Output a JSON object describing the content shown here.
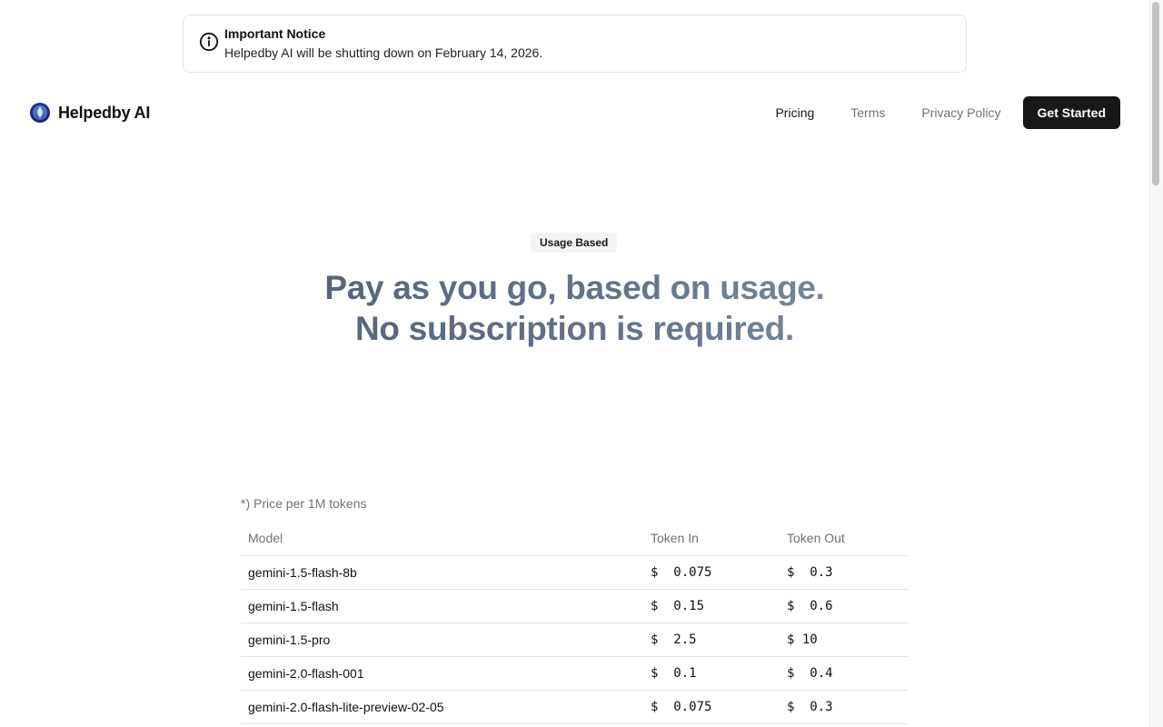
{
  "notice": {
    "title": "Important Notice",
    "message": "Helpedby AI will be shutting down on February 14, 2026.",
    "icon": "info-icon"
  },
  "brand": {
    "name": "Helpedby AI",
    "logo_icon": "helpedby-logo"
  },
  "nav": {
    "links": [
      "Pricing",
      "Terms",
      "Privacy Policy"
    ],
    "active": "Pricing",
    "cta_label": "Get Started"
  },
  "hero": {
    "badge": "Usage Based",
    "line1": "Pay as you go, based on usage.",
    "line2": "No subscription is required."
  },
  "pricing": {
    "note": "*) Price per 1M tokens",
    "columns": [
      "Model",
      "Token In",
      "Token Out"
    ],
    "currency": "$",
    "rows": [
      {
        "model": "gemini-1.5-flash-8b",
        "token_in": "0.075",
        "token_out": "0.3"
      },
      {
        "model": "gemini-1.5-flash",
        "token_in": "0.15",
        "token_out": "0.6"
      },
      {
        "model": "gemini-1.5-pro",
        "token_in": "2.5",
        "token_out": "10"
      },
      {
        "model": "gemini-2.0-flash-001",
        "token_in": "0.1",
        "token_out": "0.4"
      },
      {
        "model": "gemini-2.0-flash-lite-preview-02-05",
        "token_in": "0.075",
        "token_out": "0.3"
      }
    ]
  },
  "colors": {
    "primary": "#18181b",
    "muted": "#71717a",
    "border": "#e4e4e7",
    "hero_gradient_start": "#475569",
    "hero_gradient_end": "#94a3b8"
  }
}
